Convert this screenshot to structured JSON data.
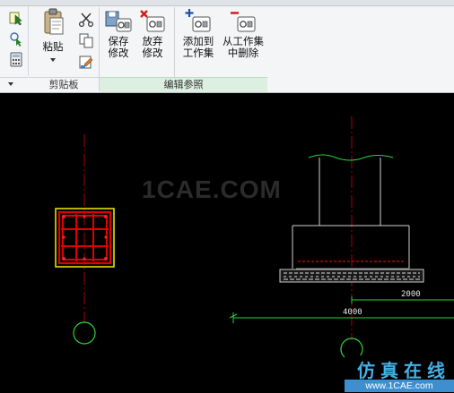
{
  "ribbon": {
    "clipboard_panel": {
      "label": "剪贴板",
      "paste_label": "粘贴"
    },
    "edit_ref_panel": {
      "label": "编辑参照",
      "save_label": "保存\n修改",
      "discard_label": "放弃\n修改",
      "add_label": "添加到\n工作集",
      "remove_label": "从工作集\n中删除"
    }
  },
  "canvas": {
    "watermark": "1CAE.COM",
    "dimension_2000": "2000",
    "dimension_4000": "4000"
  },
  "logo": {
    "cn_text": "仿真在线",
    "url": "www.1CAE.com"
  },
  "colors": {
    "column_red": "#e00000",
    "highlight_yellow": "#f0f000",
    "grid_red": "#c00000",
    "cad_green": "#2bd63a",
    "logo_blue": "#3e8fcf"
  }
}
